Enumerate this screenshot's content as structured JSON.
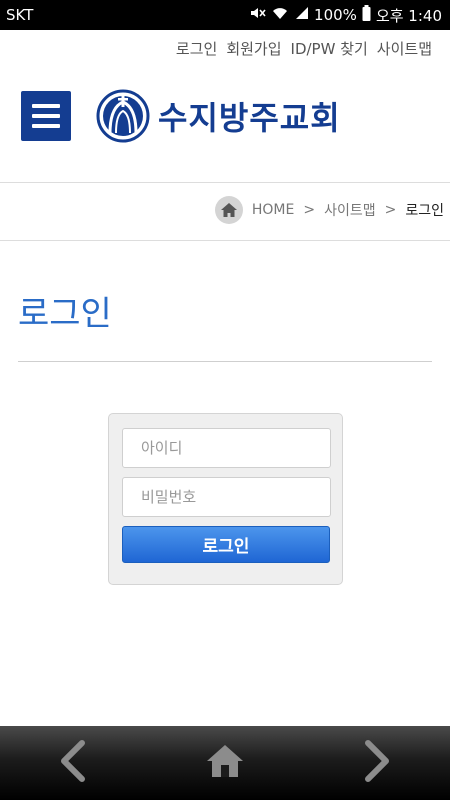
{
  "status_bar": {
    "carrier": "SKT",
    "battery": "100%",
    "time": "오후 1:40"
  },
  "top_links": [
    "로그인",
    "회원가입",
    "ID/PW 찾기",
    "사이트맵"
  ],
  "header": {
    "site_name": "수지방주교회"
  },
  "breadcrumb": {
    "items": [
      "HOME",
      "사이트맵",
      "로그인"
    ],
    "separator": ">"
  },
  "page": {
    "title": "로그인"
  },
  "login_form": {
    "id_placeholder": "아이디",
    "id_value": "",
    "pw_placeholder": "비밀번호",
    "pw_value": "",
    "button_label": "로그인"
  },
  "colors": {
    "brand_navy": "#143d91",
    "title_blue": "#2a6cc7",
    "button_blue": "#2e79df"
  },
  "icons": {
    "menu": "hamburger-icon",
    "breadcrumb_home": "home-icon",
    "nav_back": "chevron-left-icon",
    "nav_home": "home-icon",
    "nav_forward": "chevron-right-icon"
  }
}
